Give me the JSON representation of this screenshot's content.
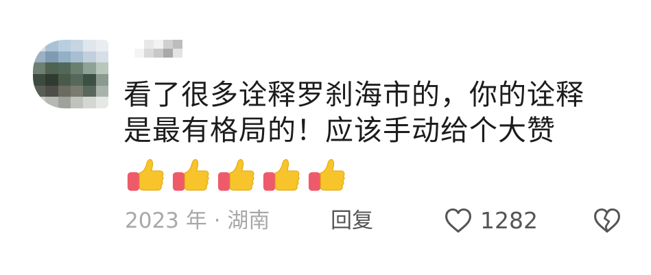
{
  "comment": {
    "avatar": {
      "icon": "avatar-mosaic",
      "colors": [
        "#d9dde2",
        "#a9c2d6",
        "#b9cfe0",
        "#c6d5e2",
        "#dfe6ec",
        "#e9edf1",
        "#9bb0c2",
        "#7f9bb1",
        "#93b0c6",
        "#a8bfd1",
        "#c1d0dc",
        "#d7dfe6",
        "#6f7f72",
        "#4f6353",
        "#52685a",
        "#6b7f6f",
        "#8fa395",
        "#b8c6bc",
        "#3c4a3f",
        "#2f3a31",
        "#4a5a4a",
        "#56685a",
        "#3e5044",
        "#8a9a8e",
        "#5a5d55",
        "#4c4e47",
        "#6b6b5f",
        "#7a7c70",
        "#59675d",
        "#a9b3ab",
        "#c9cbc7",
        "#b6b8b2",
        "#9fa29a",
        "#c0c3bc",
        "#d4d7d2",
        "#e6e8e5"
      ]
    },
    "username_blur": {
      "colors": [
        "#ffffff",
        "#e8e8e8",
        "#f2f2f2",
        "#d0d0d0",
        "#bdbdbd",
        "#f4f4f4",
        "#d9d9d9",
        "#c8c8c8",
        "#a9a9a9",
        "#e3e3e3"
      ]
    },
    "text_lines": [
      "看了很多诠释罗刹海市的，你的诠释",
      "是最有格局的！应该手动给个大赞"
    ],
    "emojis": [
      "thumbs-up",
      "thumbs-up",
      "thumbs-up",
      "thumbs-up",
      "thumbs-up"
    ],
    "meta": "2023 年 · 湖南",
    "reply_label": "回复",
    "like_count": "1282",
    "colors": {
      "text": "#1c1c1c",
      "meta": "#a8a8a8",
      "action": "#555555",
      "thumb_yellow": "#f7c52b",
      "cuff_red": "#ef5a6b"
    }
  }
}
